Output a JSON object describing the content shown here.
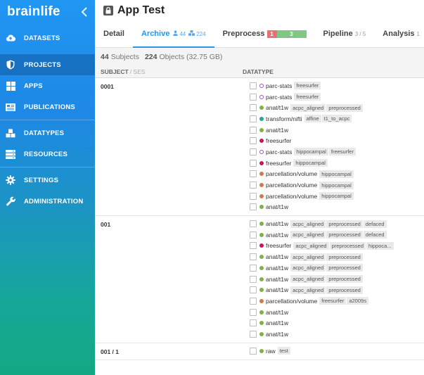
{
  "sidebar": {
    "brand": "brainlife",
    "items": [
      {
        "label": "DATASETS",
        "icon": "cloud-upload-icon",
        "active": false
      },
      {
        "label": "PROJECTS",
        "icon": "shield-icon",
        "active": true
      },
      {
        "label": "APPS",
        "icon": "grid-icon",
        "active": false
      },
      {
        "label": "PUBLICATIONS",
        "icon": "newspaper-icon",
        "active": false
      },
      {
        "label": "DATATYPES",
        "icon": "cubes-icon",
        "active": false
      },
      {
        "label": "RESOURCES",
        "icon": "server-icon",
        "active": false
      },
      {
        "label": "SETTINGS",
        "icon": "gear-icon",
        "active": false
      },
      {
        "label": "ADMINISTRATION",
        "icon": "wrench-icon",
        "active": false
      }
    ]
  },
  "header": {
    "title": "App Test"
  },
  "tabs": {
    "detail": "Detail",
    "archive": "Archive",
    "archive_subjects": "44",
    "archive_objects": "224",
    "preprocess": "Preprocess",
    "preprocess_failed": "1",
    "preprocess_done": "3",
    "pipeline": "Pipeline",
    "pipeline_count": "3 / 5",
    "analysis": "Analysis",
    "analysis_count": "1"
  },
  "summary": {
    "subjects": "44",
    "subjects_label": "Subjects",
    "objects": "224",
    "objects_label": "Objects (32.75 GB)"
  },
  "columns": {
    "subject": "SUBJECT",
    "ses": "/ SES",
    "datatype": "DATATYPE"
  },
  "colors": {
    "purple": "#a64ccf",
    "green": "#7cb342",
    "teal": "#26a69a",
    "magenta": "#c2185b",
    "orange": "#d07a4f",
    "accent": "#2196f3"
  },
  "groups": [
    {
      "subject": "0001",
      "rows": [
        {
          "dot": "ring",
          "color": "#a64ccf",
          "name": "parc-stats",
          "tags": [
            "freesurfer"
          ]
        },
        {
          "dot": "ring",
          "color": "#a64ccf",
          "name": "parc-stats",
          "tags": [
            "freesurfer"
          ]
        },
        {
          "dot": "fill",
          "color": "#7cb342",
          "name": "anat/t1w",
          "tags": [
            "acpc_aligned",
            "preprocessed"
          ]
        },
        {
          "dot": "fill",
          "color": "#26a69a",
          "name": "transform/nifti",
          "tags": [
            "affine",
            "t1_to_acpc"
          ]
        },
        {
          "dot": "fill",
          "color": "#7cb342",
          "name": "anat/t1w",
          "tags": []
        },
        {
          "dot": "fill",
          "color": "#c2185b",
          "name": "freesurfer",
          "tags": []
        },
        {
          "dot": "ring",
          "color": "#a64ccf",
          "name": "parc-stats",
          "tags": [
            "hippocampal",
            "freesurfer"
          ]
        },
        {
          "dot": "fill",
          "color": "#c2185b",
          "name": "freesurfer",
          "tags": [
            "hippocampal"
          ]
        },
        {
          "dot": "fill",
          "color": "#d07a4f",
          "name": "parcellation/volume",
          "tags": [
            "hippocampal"
          ]
        },
        {
          "dot": "fill",
          "color": "#d07a4f",
          "name": "parcellation/volume",
          "tags": [
            "hippocampal"
          ]
        },
        {
          "dot": "fill",
          "color": "#d07a4f",
          "name": "parcellation/volume",
          "tags": [
            "hippocampal"
          ]
        },
        {
          "dot": "fill",
          "color": "#7cb342",
          "name": "anat/t1w",
          "tags": []
        }
      ]
    },
    {
      "subject": "001",
      "rows": [
        {
          "dot": "fill",
          "color": "#7cb342",
          "name": "anat/t1w",
          "tags": [
            "acpc_aligned",
            "preprocessed",
            "defaced"
          ]
        },
        {
          "dot": "fill",
          "color": "#7cb342",
          "name": "anat/t1w",
          "tags": [
            "acpc_aligned",
            "preprocessed",
            "defaced"
          ]
        },
        {
          "dot": "fill",
          "color": "#c2185b",
          "name": "freesurfer",
          "tags": [
            "acpc_aligned",
            "preprocessed",
            "hippoca..."
          ]
        },
        {
          "dot": "fill",
          "color": "#7cb342",
          "name": "anat/t1w",
          "tags": [
            "acpc_aligned",
            "preprocessed"
          ]
        },
        {
          "dot": "fill",
          "color": "#7cb342",
          "name": "anat/t1w",
          "tags": [
            "acpc_aligned",
            "preprocessed"
          ]
        },
        {
          "dot": "fill",
          "color": "#7cb342",
          "name": "anat/t1w",
          "tags": [
            "acpc_aligned",
            "preprocessed"
          ]
        },
        {
          "dot": "fill",
          "color": "#7cb342",
          "name": "anat/t1w",
          "tags": [
            "acpc_aligned",
            "preprocessed"
          ]
        },
        {
          "dot": "fill",
          "color": "#d07a4f",
          "name": "parcellation/volume",
          "tags": [
            "freesurfer",
            "a2009s"
          ]
        },
        {
          "dot": "fill",
          "color": "#7cb342",
          "name": "anat/t1w",
          "tags": []
        },
        {
          "dot": "fill",
          "color": "#7cb342",
          "name": "anat/t1w",
          "tags": []
        },
        {
          "dot": "fill",
          "color": "#7cb342",
          "name": "anat/t1w",
          "tags": []
        }
      ]
    },
    {
      "subject": "001 / 1",
      "rows": [
        {
          "dot": "fill",
          "color": "#7cb342",
          "name": "raw",
          "tags": [
            "test"
          ]
        }
      ]
    }
  ]
}
